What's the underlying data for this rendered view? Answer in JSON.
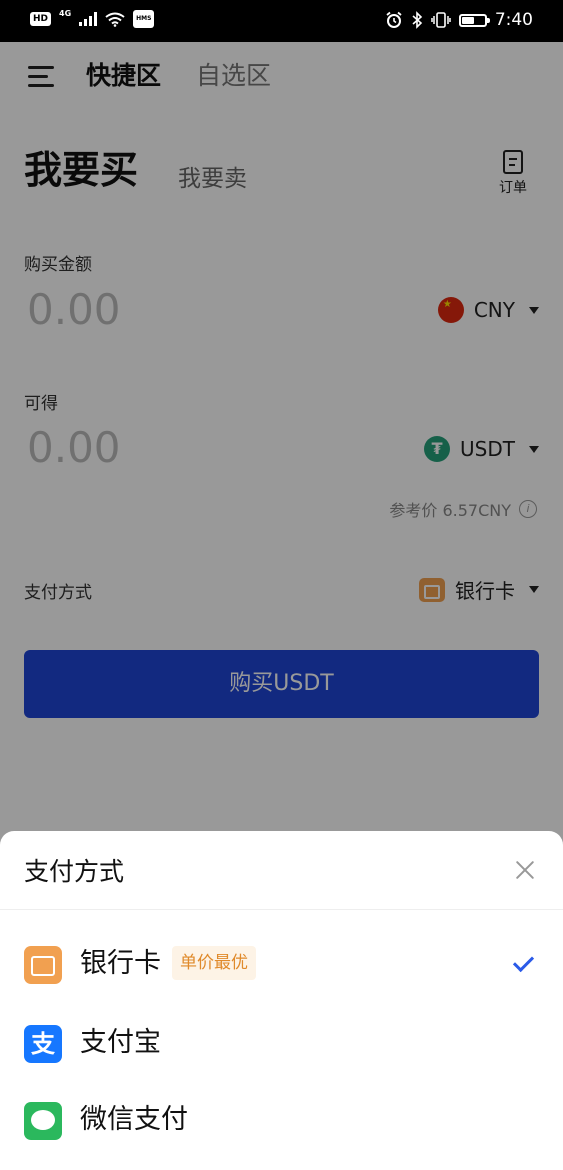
{
  "status_bar": {
    "left_badge": "HD",
    "network": "4G",
    "hms_badge": "HMS",
    "time": "7:40",
    "battery_level": 0.55
  },
  "nav": {
    "tabs": [
      {
        "label": "快捷区",
        "active": true
      },
      {
        "label": "自选区",
        "active": false
      }
    ]
  },
  "trade": {
    "tabs": [
      {
        "label": "我要买",
        "active": true
      },
      {
        "label": "我要卖",
        "active": false
      }
    ],
    "orders_label": "订单",
    "buy_amount": {
      "label": "购买金额",
      "value": "0.00",
      "currency": "CNY"
    },
    "receive": {
      "label": "可得",
      "value": "0.00",
      "currency": "USDT"
    },
    "reference_price": "参考价 6.57CNY",
    "payment": {
      "label": "支付方式",
      "selected": "银行卡"
    },
    "buy_button": "购买USDT"
  },
  "sheet": {
    "title": "支付方式",
    "options": [
      {
        "label": "银行卡",
        "tag": "单价最优",
        "selected": true,
        "icon": "bank-card-icon"
      },
      {
        "label": "支付宝",
        "tag": "",
        "selected": false,
        "icon": "alipay-icon"
      },
      {
        "label": "微信支付",
        "tag": "",
        "selected": false,
        "icon": "wechat-pay-icon"
      }
    ]
  },
  "colors": {
    "primary": "#1e45d6",
    "bank": "#f1a050",
    "alipay": "#1677ff",
    "wechat": "#2bb85d",
    "check": "#2a5ae8"
  }
}
